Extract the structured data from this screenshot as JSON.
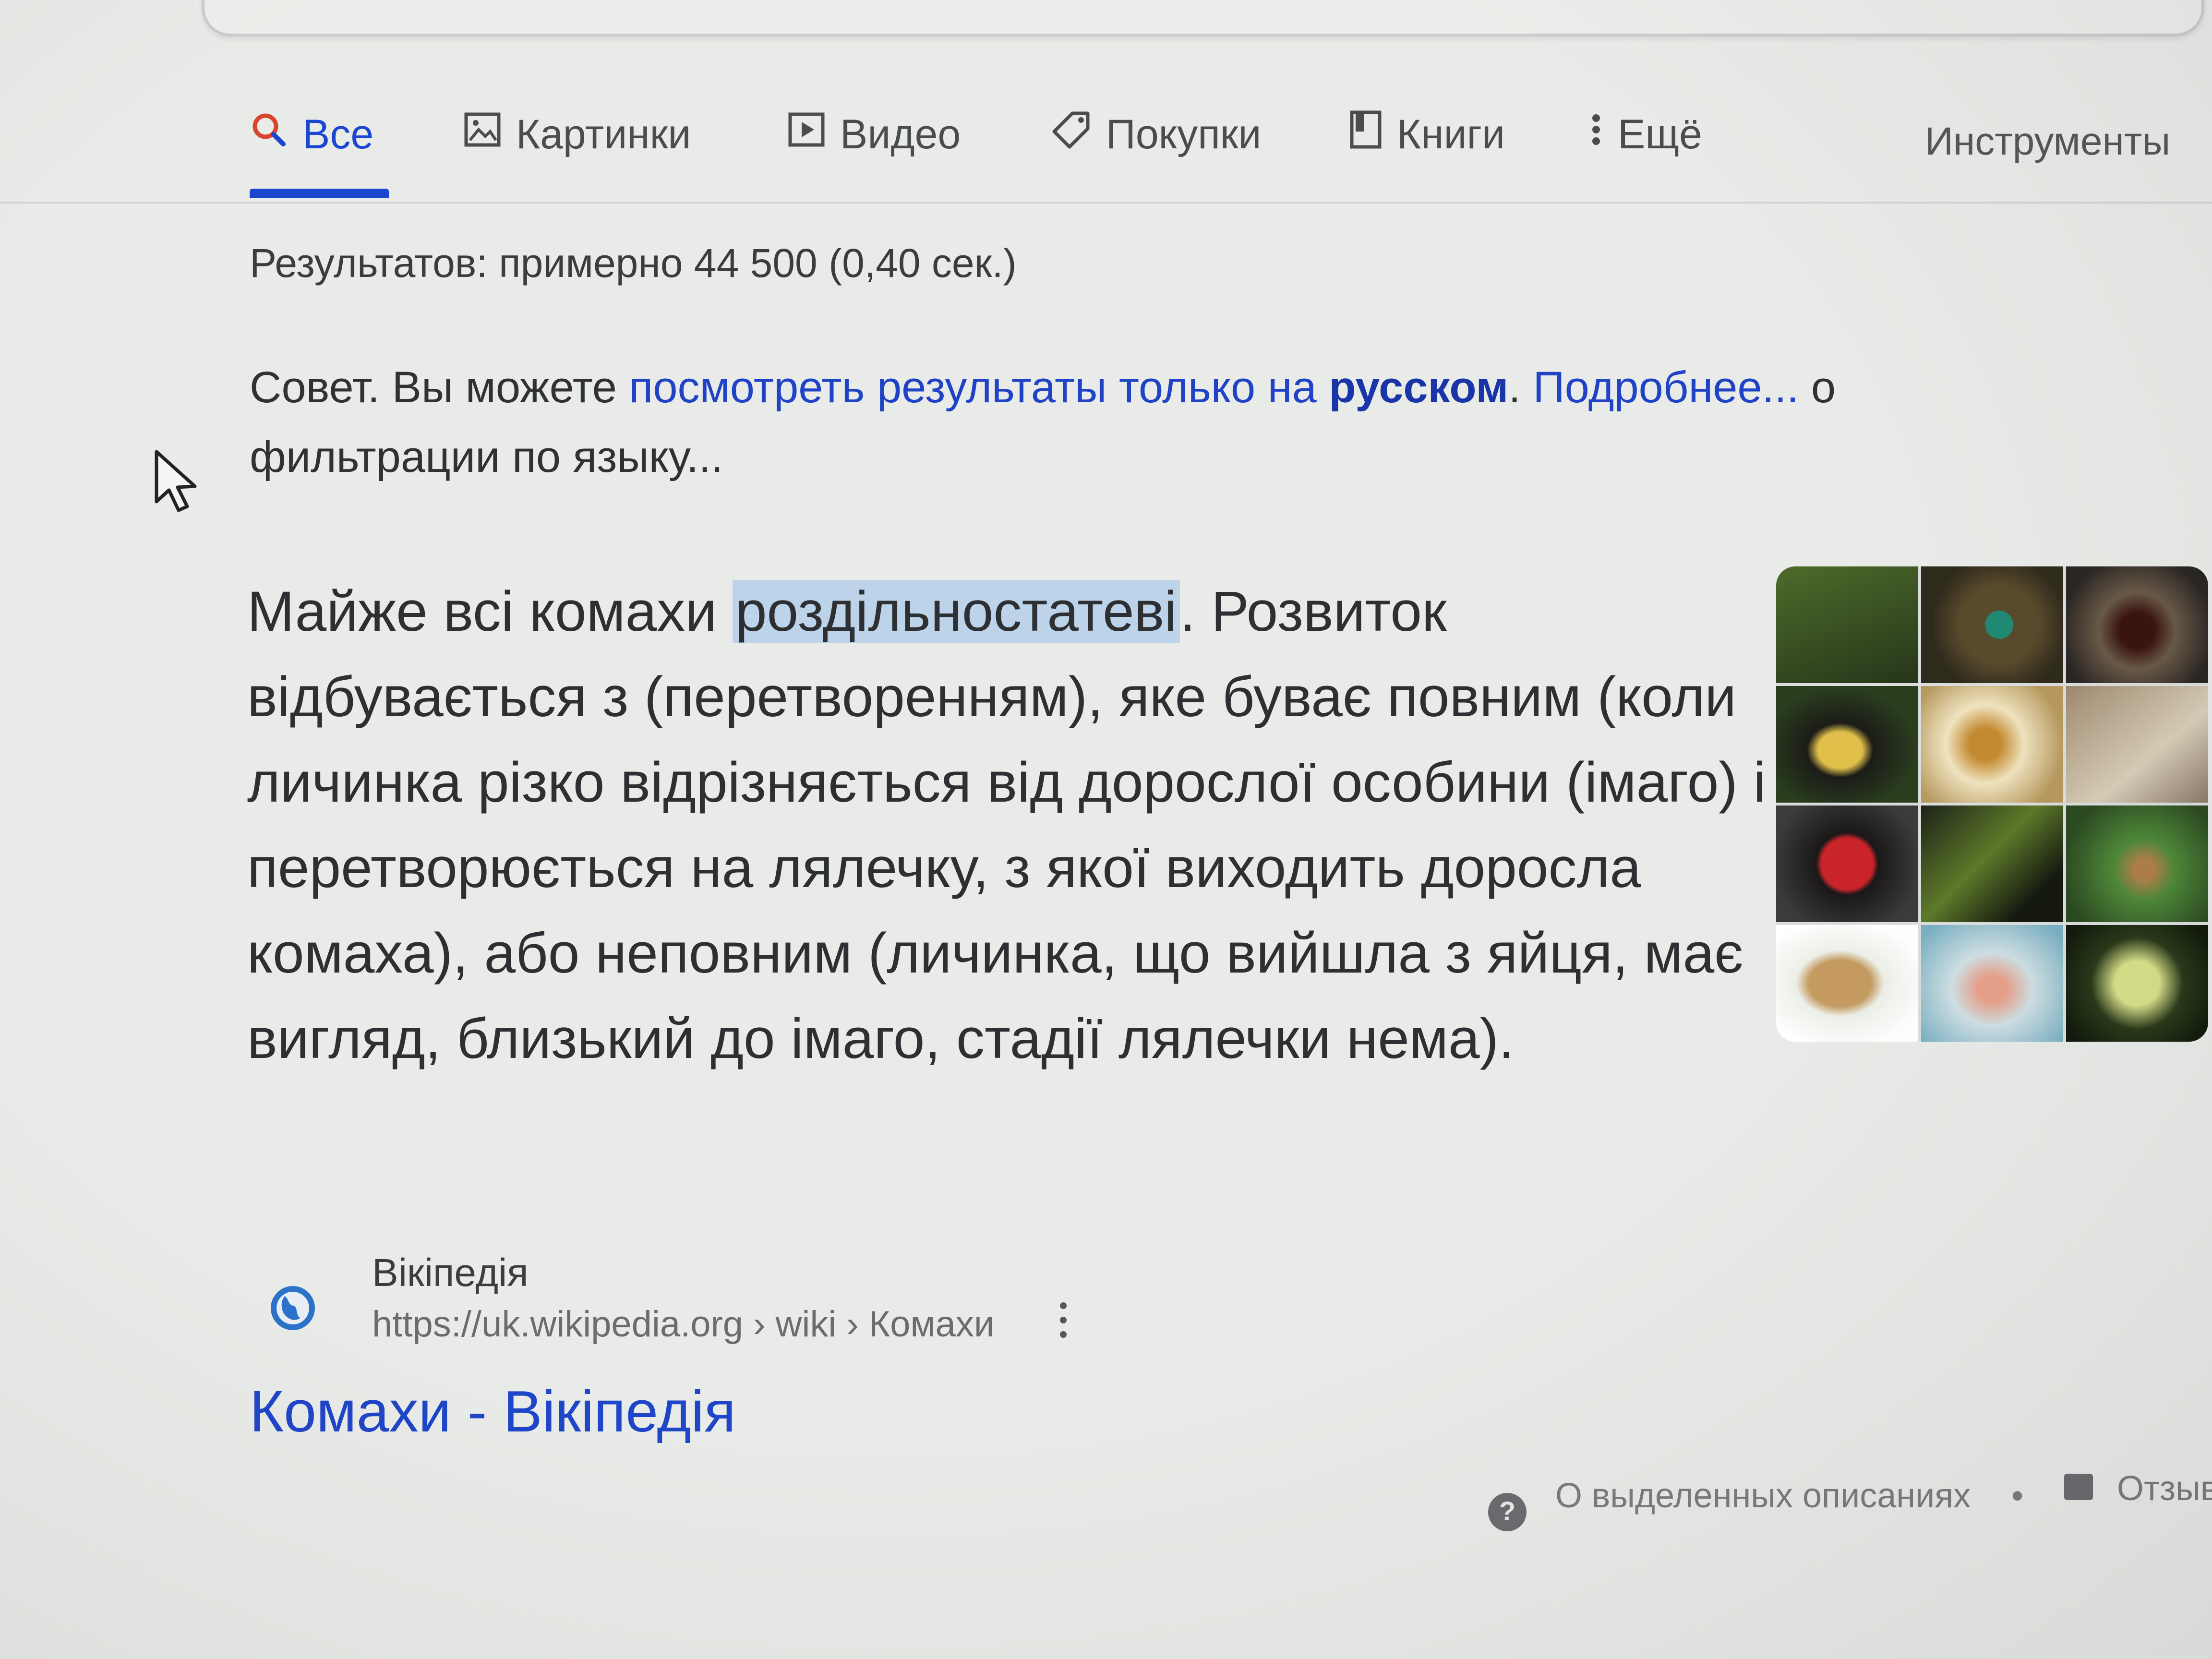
{
  "tabs": [
    {
      "label": "Все",
      "icon": "search-icon",
      "active": true
    },
    {
      "label": "Картинки",
      "icon": "image-icon"
    },
    {
      "label": "Видео",
      "icon": "video-play-icon"
    },
    {
      "label": "Покупки",
      "icon": "tag-icon"
    },
    {
      "label": "Книги",
      "icon": "book-icon"
    },
    {
      "label": "Ещё",
      "icon": "more-vert-icon"
    }
  ],
  "tools_label": "Инструменты",
  "stats": "Результатов: примерно 44 500 (0,40 сек.)",
  "tip": {
    "prefix": "Совет. Вы можете ",
    "link1": "посмотреть результаты только на ",
    "lang": "русском",
    "period": ". ",
    "link2": "Подробнее...",
    "tail1": " о",
    "tail2": "фильтрации по языку..."
  },
  "snippet": {
    "before": "Майже всі комахи ",
    "highlight": "роздільностатеві",
    "after": ". Розвиток відбувається з (перетворенням), яке буває повним (коли личинка різко відрізняється від дорослої особини (імаго) і перетворюється на лялечку, з якої виходить доросла комаха), або неповним (личинка, що вийшла з яйця, має вигляд, близький до імаго, стадії лялечки нема)."
  },
  "source": {
    "name": "Вікіпедія",
    "url": "https://uk.wikipedia.org › wiki › Комахи",
    "icon": "globe-icon"
  },
  "result_title": "Комахи - Вікіпедія",
  "footer": {
    "help_icon": "help-circle-icon",
    "about": "О выделенных описаниях",
    "dot": "•",
    "feedback_icon": "feedback-icon",
    "feedback": "Отзыв"
  },
  "colors": {
    "accent": "#1a46d0",
    "link": "#1f42c6",
    "highlight": "#bcd3ea"
  }
}
